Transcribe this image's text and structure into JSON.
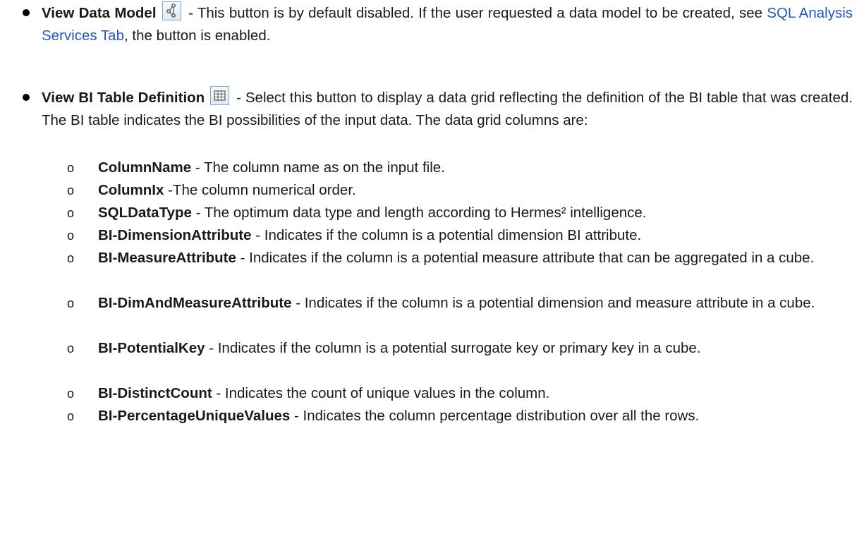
{
  "item1": {
    "term": "View Data Model",
    "icon": "data-model-icon",
    "text_before_link": "- This button is by default disabled. If the user requested a data model to be created, see ",
    "link": "SQL Analysis Services Tab",
    "text_after_link": ", the button is enabled."
  },
  "item2": {
    "term": "View BI Table Definition",
    "icon": "table-grid-icon",
    "text": "- Select this button to display a data grid reflecting the definition of the BI table that was created. The BI table indicates the BI possibilities of the input data. The data grid columns are:"
  },
  "columns": [
    {
      "name": "ColumnName",
      "desc": " - The column name as on the input file."
    },
    {
      "name": "ColumnIx",
      "desc": " -The column numerical order."
    },
    {
      "name": "SQLDataType",
      "desc": " - The optimum data type and length according to Hermes² intelligence."
    },
    {
      "name": "BI-DimensionAttribute",
      "desc": " - Indicates if the column is a potential dimension BI attribute."
    },
    {
      "name": "BI-MeasureAttribute",
      "desc": " - Indicates if the column is a potential measure attribute that can be aggregated in a cube."
    },
    {
      "name": "BI-DimAndMeasureAttribute",
      "desc": " - Indicates if the column is a potential dimension and measure attribute in a cube."
    },
    {
      "name": "BI-PotentialKey",
      "desc": " - Indicates if the column is a potential surrogate key or primary key in a cube."
    },
    {
      "name": "BI-DistinctCount",
      "desc": " - Indicates the count of unique values in the column."
    },
    {
      "name": "BI-PercentageUniqueValues",
      "desc": " - Indicates the column percentage distribution over all the rows."
    }
  ]
}
